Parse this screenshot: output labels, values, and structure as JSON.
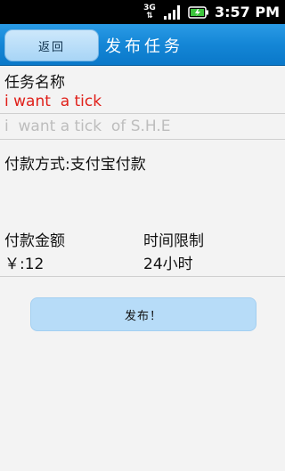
{
  "status_bar": {
    "network_type": "3G",
    "time": "3:57 PM"
  },
  "header": {
    "back_label": "返回",
    "title": "发布任务"
  },
  "task": {
    "name_label": "任务名称",
    "name_value": "i want  a tick",
    "description": "i  want a tick  of S.H.E"
  },
  "payment": {
    "method_label": "付款方式:支付宝付款",
    "amount_label": "付款金额",
    "amount_value": "￥:12",
    "time_limit_label": "时间限制",
    "time_limit_value": "24小时"
  },
  "actions": {
    "publish_label": "发布！"
  },
  "colors": {
    "titlebar": "#1486d6",
    "task_name_text": "#e0201a",
    "placeholder_text": "#bdbdbd",
    "button_fill": "#b7dcf8"
  },
  "icons": [
    "network-3g-icon",
    "signal-strength-icon",
    "battery-icon"
  ]
}
